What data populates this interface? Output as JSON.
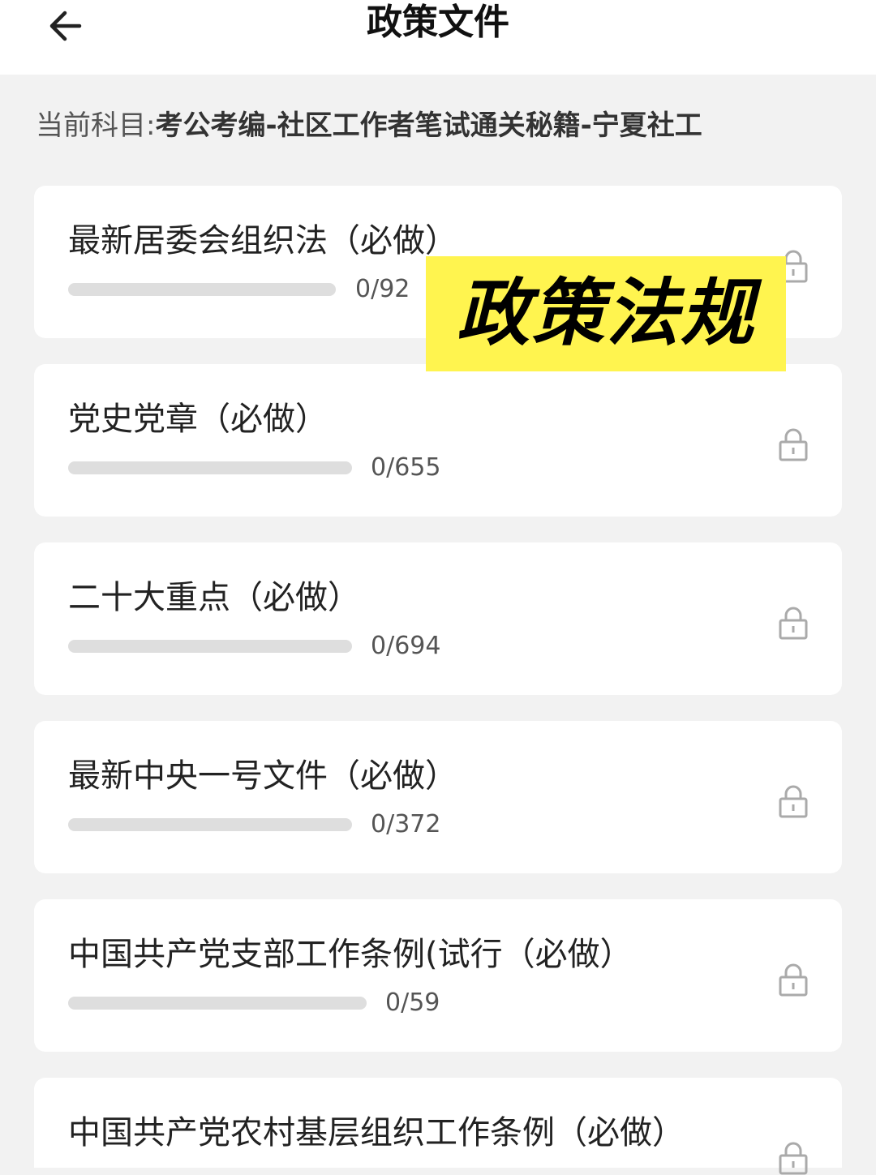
{
  "header": {
    "title": "政策文件"
  },
  "subject": {
    "prefix": "当前科目:",
    "name": "考公考编-社区工作者笔试通关秘籍-宁夏社工"
  },
  "overlay": {
    "banner_text": "政策法规"
  },
  "items": [
    {
      "title": "最新居委会组织法（必做）",
      "done": 0,
      "total": 92,
      "count": "0/92",
      "locked": true
    },
    {
      "title": "党史党章（必做）",
      "done": 0,
      "total": 655,
      "count": "0/655",
      "locked": true
    },
    {
      "title": "二十大重点（必做）",
      "done": 0,
      "total": 694,
      "count": "0/694",
      "locked": true
    },
    {
      "title": "最新中央一号文件（必做）",
      "done": 0,
      "total": 372,
      "count": "0/372",
      "locked": true
    },
    {
      "title": "中国共产党支部工作条例(试行（必做）",
      "done": 0,
      "total": 59,
      "count": "0/59",
      "locked": true
    },
    {
      "title": "中国共产党农村基层组织工作条例（必做）",
      "done": 0,
      "total": null,
      "count": "",
      "locked": true
    }
  ],
  "icons": {
    "back": "arrow-left-icon",
    "lock": "lock-icon"
  },
  "colors": {
    "banner_bg": "#fff44f",
    "page_bg": "#f2f2f2",
    "track": "#dedede"
  }
}
